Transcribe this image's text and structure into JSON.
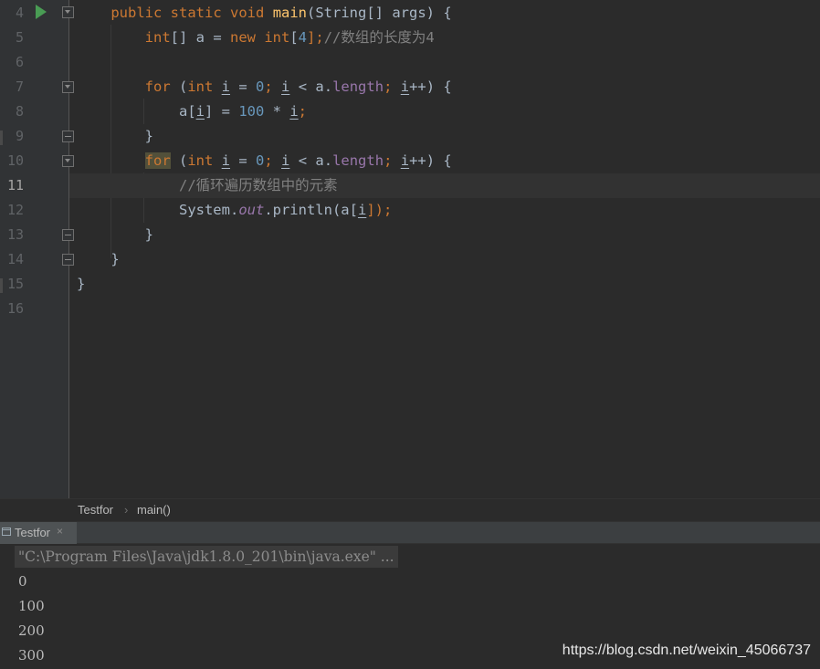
{
  "editor": {
    "line_numbers": [
      "4",
      "5",
      "6",
      "7",
      "8",
      "9",
      "10",
      "11",
      "12",
      "13",
      "14",
      "15",
      "16"
    ],
    "current_line": "11",
    "code": {
      "l4": {
        "kw1": "public",
        "kw2": "static",
        "kw3": "void",
        "fn": "main",
        "rest": "(String[] args) {"
      },
      "l5": {
        "kw1": "int",
        "p1": "[] a = ",
        "kw2": "new",
        "kw3": "int",
        "p2": "[",
        "num": "4",
        "p3": "];",
        "cmt": "//数组的长度为4"
      },
      "l7": {
        "kw1": "for",
        "p1": " (",
        "kw2": "int",
        "v1": "i",
        "p2": " = ",
        "num": "0",
        "p3": ";",
        "v2": "i",
        "p4": " < a.",
        "field": "length",
        "p5": ";",
        "v3": "i",
        "p6": "++) {"
      },
      "l8": {
        "p1": "a[",
        "v1": "i",
        "p2": "] = ",
        "num": "100",
        "p3": " * ",
        "v2": "i",
        "p4": ";"
      },
      "l9": "}",
      "l10": {
        "kw1": "for",
        "p1": " (",
        "kw2": "int",
        "v1": "i",
        "p2": " = ",
        "num": "0",
        "p3": ";",
        "v2": "i",
        "p4": " < a.",
        "field": "length",
        "p5": ";",
        "v3": "i",
        "p6": "++) {"
      },
      "l11": "//循环遍历数组中的元素",
      "l12": {
        "p1": "System.",
        "ital": "out",
        "p2": ".println(a[",
        "v1": "i",
        "p3": "]);"
      },
      "l13": "}",
      "l14": "}",
      "l15": "}"
    }
  },
  "breadcrumb": {
    "items": [
      "Testfor",
      "main()"
    ],
    "separator": "›"
  },
  "run_panel": {
    "tab_label": "Testfor",
    "tab_close": "×",
    "command": "\"C:\\Program Files\\Java\\jdk1.8.0_201\\bin\\java.exe\" ...",
    "output": [
      "0",
      "100",
      "200",
      "300"
    ]
  },
  "watermark": "https://blog.csdn.net/weixin_45066737",
  "colors": {
    "keyword": "#cc7832",
    "function": "#ffc66d",
    "number": "#6897bb",
    "field": "#9876aa",
    "comment": "#808080",
    "run_icon": "#499c54"
  },
  "icons": [
    "run-icon",
    "fold-icon",
    "console-icon",
    "close-icon"
  ]
}
